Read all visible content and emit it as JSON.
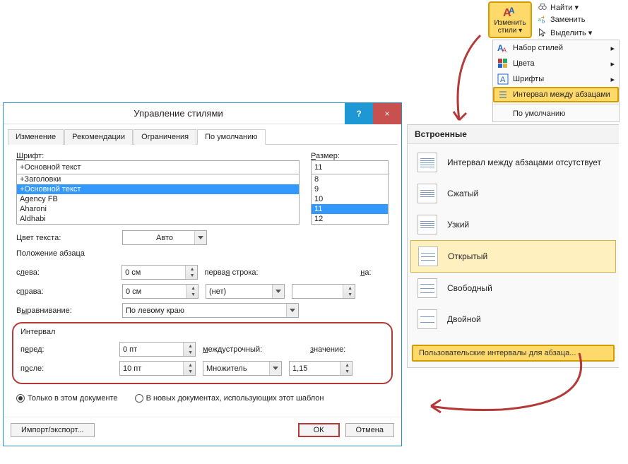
{
  "ribbon": {
    "change_styles": {
      "line1": "Изменить",
      "line2": "стили ▾"
    },
    "find": "Найти ▾",
    "replace": "Заменить",
    "select": "Выделить ▾"
  },
  "dropdown": {
    "style_set": "Набор стилей",
    "colors": "Цвета",
    "fonts": "Шрифты",
    "paragraph_spacing": "Интервал между абзацами",
    "default": "По умолчанию"
  },
  "builtin": {
    "header": "Встроенные",
    "items": [
      "Интервал между абзацами отсутствует",
      "Сжатый",
      "Узкий",
      "Открытый",
      "Свободный",
      "Двойной"
    ],
    "custom": "Пользовательские интервалы для абзаца..."
  },
  "dialog": {
    "title": "Управление стилями",
    "help": "?",
    "close": "×",
    "tabs": [
      "Изменение",
      "Рекомендации",
      "Ограничения",
      "По умолчанию"
    ],
    "font_label": "Шрифт:",
    "size_label": "Размер:",
    "font_value": "+Основной текст",
    "size_value": "11",
    "font_options": [
      "+Заголовки",
      "+Основной текст",
      "Agency FB",
      "Aharoni",
      "Aldhabi"
    ],
    "size_options": [
      "8",
      "9",
      "10",
      "11",
      "12"
    ],
    "text_color_label": "Цвет текста:",
    "text_color_value": "Авто",
    "position_header": "Положение абзаца",
    "left_label": "слева:",
    "right_label": "справа:",
    "alignment_label": "Выравнивание:",
    "first_line_label": "первая строка:",
    "by_label": "на:",
    "left_value": "0 см",
    "right_value": "0 см",
    "alignment_value": "По левому краю",
    "first_line_value": "(нет)",
    "interval_header": "Интервал",
    "before_label": "перед:",
    "after_label": "после:",
    "line_spacing_label": "междустрочный:",
    "value_label": "значение:",
    "before_value": "0 пт",
    "after_value": "10 пт",
    "line_spacing_value": "Множитель",
    "value_value": "1,15",
    "radio_this_doc": "Только в этом документе",
    "radio_new_docs": "В новых документах, использующих этот шаблон",
    "import_export": "Импорт/экспорт...",
    "ok": "ОК",
    "cancel": "Отмена"
  }
}
